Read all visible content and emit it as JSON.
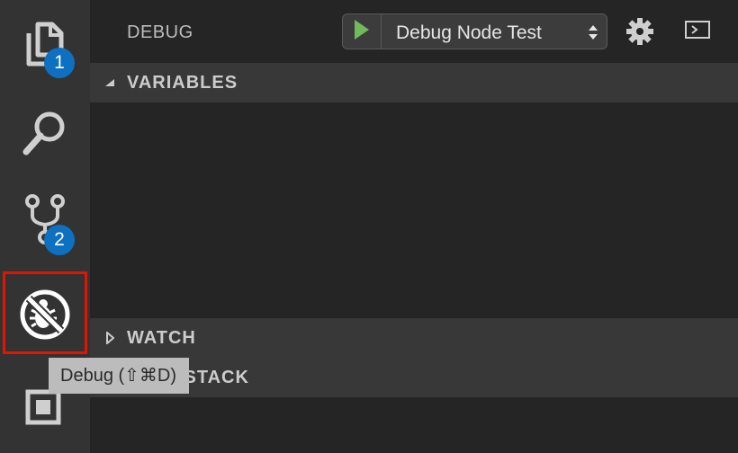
{
  "activity_bar": {
    "items": [
      {
        "icon": "files-icon",
        "badge": "1"
      },
      {
        "icon": "search-icon"
      },
      {
        "icon": "source-control-icon",
        "badge": "2"
      },
      {
        "icon": "debug-icon",
        "selected": true
      },
      {
        "icon": "extensions-icon"
      }
    ],
    "highlight_color": "#e51400",
    "badge_color": "#0e70c0"
  },
  "sidebar": {
    "title": "DEBUG",
    "configuration": {
      "selected": "Debug Node Test"
    },
    "run_icon": "play-icon",
    "run_color": "#6fba5b",
    "settings_icon": "gear-icon",
    "console_icon": "debug-console-icon",
    "sections": [
      {
        "label": "VARIABLES",
        "expanded": true
      },
      {
        "label": "WATCH",
        "expanded": false
      },
      {
        "label": "CALL STACK",
        "expanded": false
      }
    ]
  },
  "tooltip": {
    "text": "Debug (⇧⌘D)"
  }
}
